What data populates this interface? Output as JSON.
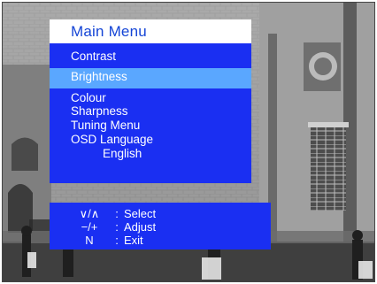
{
  "menu": {
    "title": "Main Menu",
    "items": [
      {
        "label": "Contrast"
      },
      {
        "label": "Brightness",
        "selected": true
      },
      {
        "label": "Colour"
      },
      {
        "label": "Sharpness"
      },
      {
        "label": "Tuning Menu"
      },
      {
        "label": "OSD Language"
      }
    ],
    "osd_language_value": "English"
  },
  "help": {
    "rows": [
      {
        "keys": "∨/∧",
        "sep": ":",
        "action": "Select"
      },
      {
        "keys": "−/+",
        "sep": ":",
        "action": "Adjust"
      },
      {
        "keys": "N",
        "sep": ":",
        "action": "Exit"
      }
    ]
  },
  "colors": {
    "menu_bg": "#1a2ff2",
    "title_bg": "#ffffff",
    "title_text": "#1545d6",
    "highlight": "#5aa7ff",
    "text": "#ffffff"
  }
}
